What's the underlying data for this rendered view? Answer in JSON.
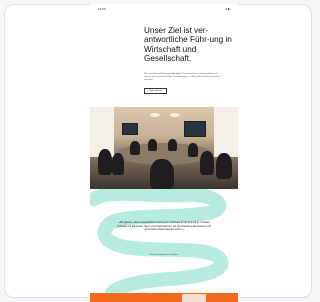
{
  "status_bar": {
    "time": "12:30",
    "icons": "●▮"
  },
  "hero": {
    "headline": "Unser Ziel ist ver-antwortliche Führ-ung in Wirtschaft und Gesellschaft.",
    "intro": "Wir unterstützen Führungskräfte dabei, Verantwortung in Organisationen zu übernehmen und nachhaltige Veränderungen in Wirtschaft und Gesellschaft zu gestalten.",
    "button_label": "Mehr erfahren"
  },
  "photo": {
    "subject": "conference-room-meeting"
  },
  "quote": {
    "text": "»Wir glauben, dass verantwortliche Führung ein Schlüssel für die Zukunft ist. Deshalb verbinden wir Menschen, Ideen und Organisationen, die Verantwortung übernehmen und gemeinsam etwas bewegen wollen.«",
    "author": "Name der Sprecherin, Funktion"
  },
  "colors": {
    "accent_orange": "#f26a1b",
    "wave_mint": "#b6ecdf"
  }
}
